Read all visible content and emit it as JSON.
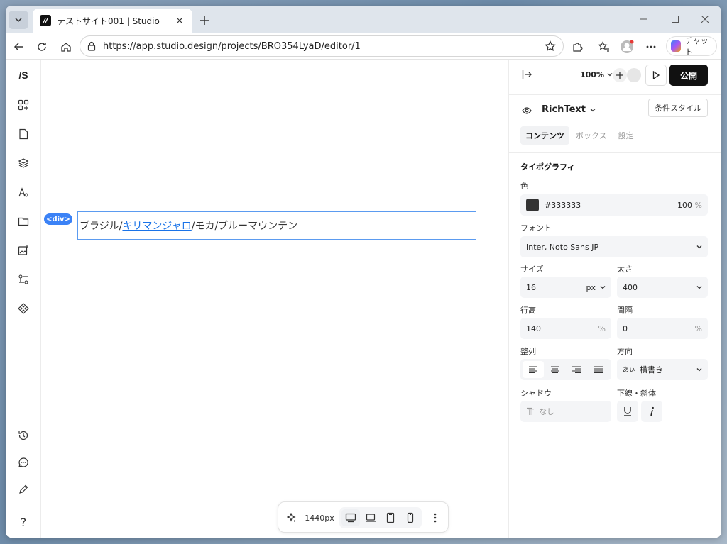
{
  "browser": {
    "tab_title": "テストサイト001 | Studio",
    "url": "https://app.studio.design/projects/BRO354LyaD/editor/1",
    "copilot_label": "チャット"
  },
  "app": {
    "logo_text": "/S",
    "canvas": {
      "element_badge": "<div>",
      "text_before": "ブラジル/",
      "text_link": "キリマンジャロ",
      "text_after": "/モカ/ブルーマウンテン"
    },
    "bottom_bar": {
      "width_label": "1440px"
    },
    "help_label": "?"
  },
  "panel": {
    "zoom": "100%",
    "publish_label": "公開",
    "component_name": "RichText",
    "condition_style_label": "条件スタイル",
    "tabs": [
      {
        "label": "コンテンツ",
        "active": true
      },
      {
        "label": "ボックス",
        "active": false
      },
      {
        "label": "設定",
        "active": false
      }
    ],
    "typography_title": "タイポグラフィ",
    "color_label": "色",
    "color_value": "#333333",
    "color_opacity": "100",
    "percent_unit": "%",
    "font_label": "フォント",
    "font_value": "Inter, Noto Sans JP",
    "size_label": "サイズ",
    "size_value": "16",
    "size_unit": "px",
    "weight_label": "太さ",
    "weight_value": "400",
    "line_height_label": "行高",
    "line_height_value": "140",
    "spacing_label": "間隔",
    "spacing_value": "0",
    "align_label": "整列",
    "direction_label": "方向",
    "direction_value": "横書き",
    "direction_icon_text": "あぃ",
    "shadow_label": "シャドウ",
    "shadow_value": "なし",
    "decoration_label": "下線・斜体"
  },
  "colors": {
    "accent": "#3b82f6",
    "link": "#1a73e8",
    "text_color": "#333333",
    "publish_bg": "#111111"
  }
}
